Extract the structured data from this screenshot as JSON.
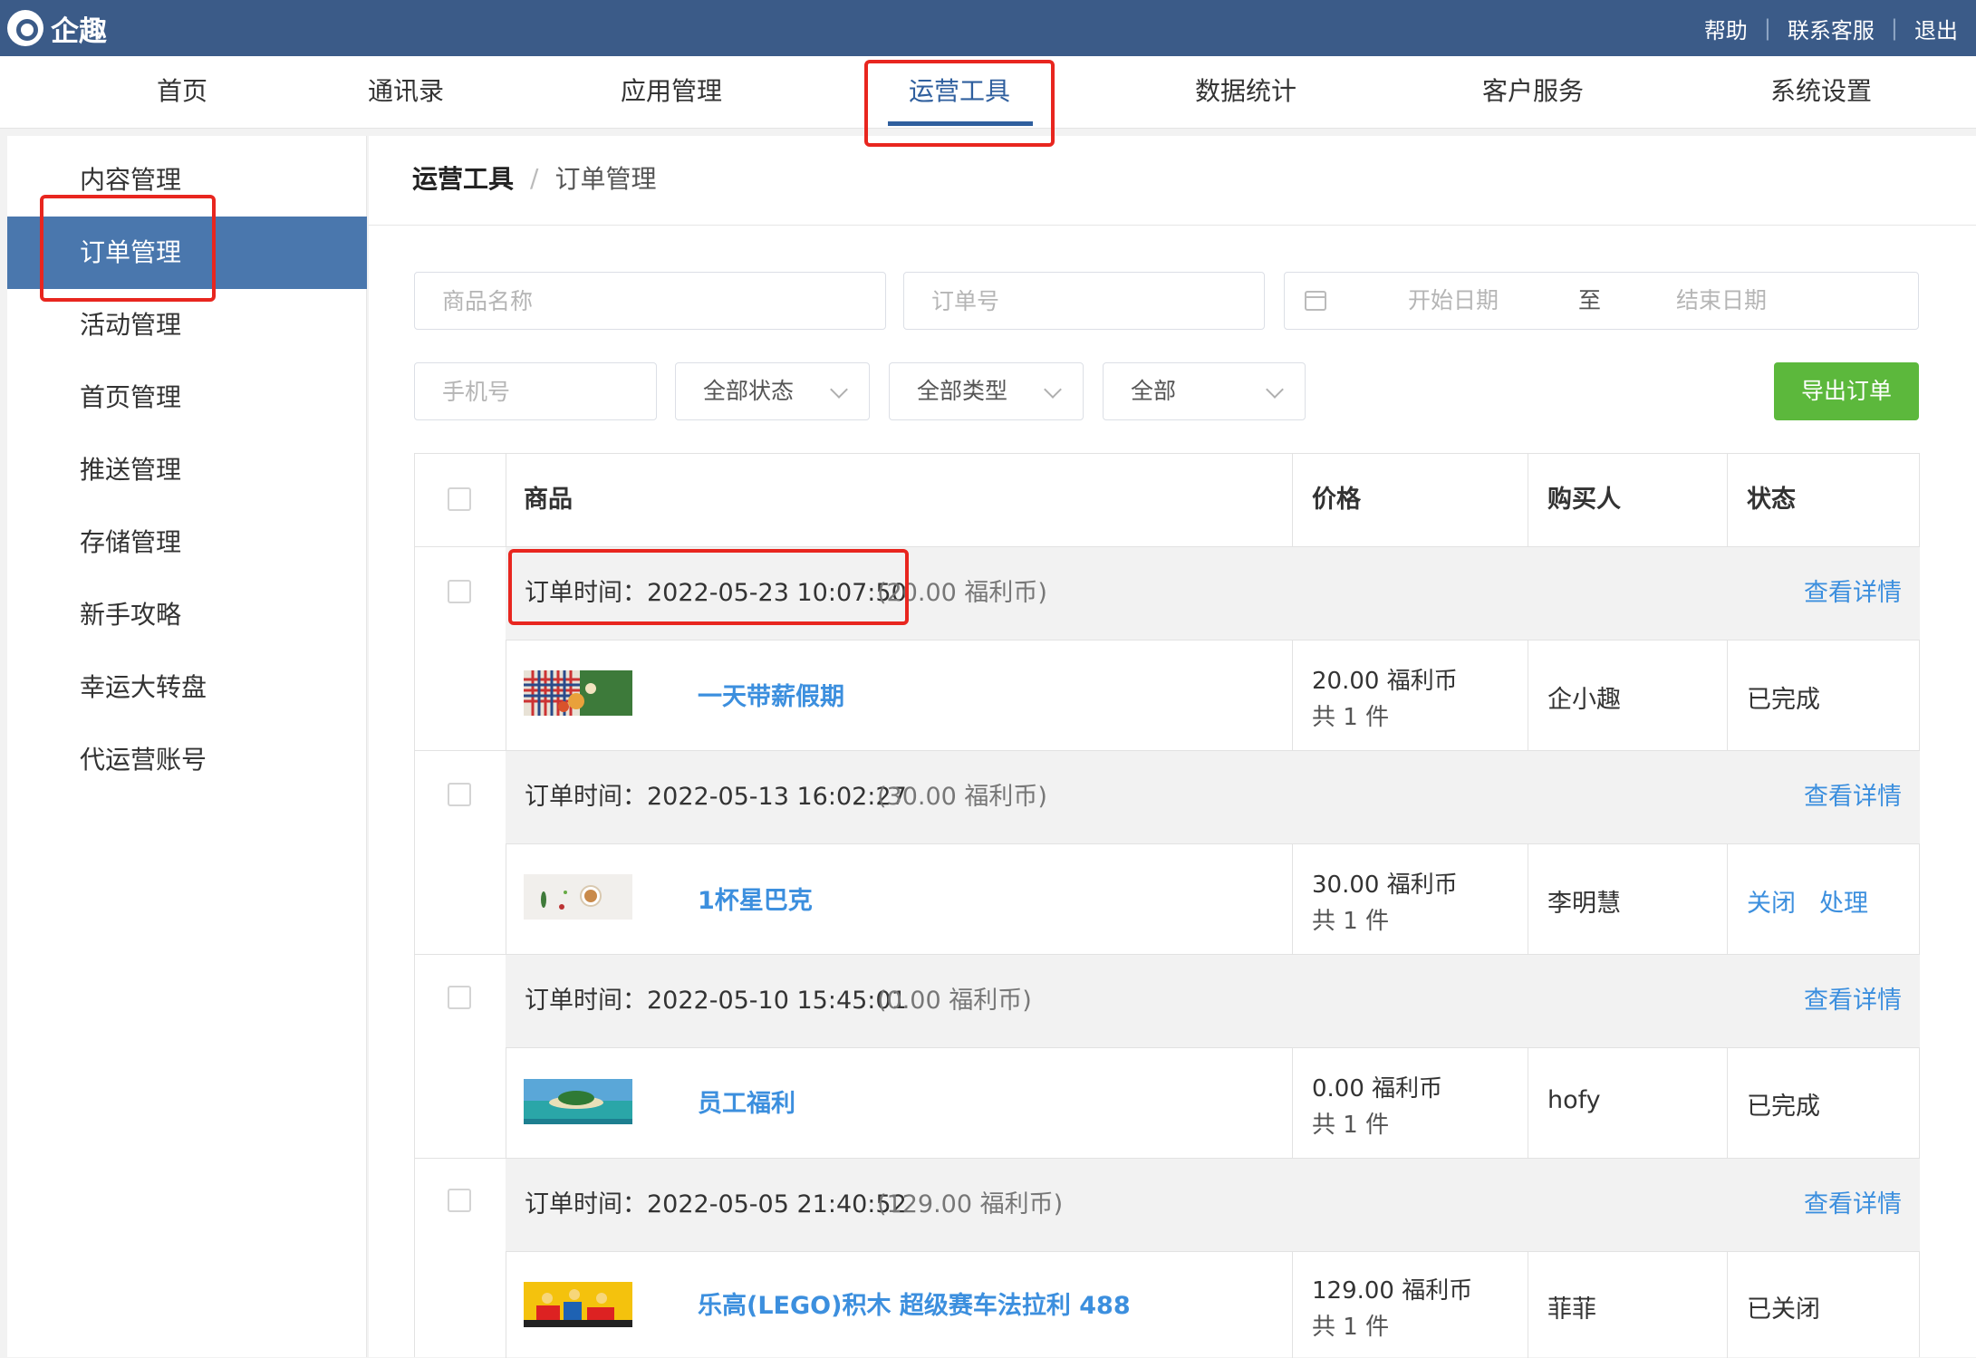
{
  "app": {
    "logo_text": "企趣"
  },
  "top_links": [
    "帮助",
    "联系客服",
    "退出"
  ],
  "main_nav": [
    "首页",
    "通讯录",
    "应用管理",
    "运营工具",
    "数据统计",
    "客户服务",
    "系统设置"
  ],
  "main_nav_active": "运营工具",
  "sidebar": [
    "内容管理",
    "订单管理",
    "活动管理",
    "首页管理",
    "推送管理",
    "存储管理",
    "新手攻略",
    "幸运大转盘",
    "代运营账号"
  ],
  "sidebar_active": "订单管理",
  "breadcrumb": {
    "root": "运营工具",
    "sep": "/",
    "current": "订单管理"
  },
  "filters": {
    "product_placeholder": "商品名称",
    "order_no_placeholder": "订单号",
    "start_date_placeholder": "开始日期",
    "date_to": "至",
    "end_date_placeholder": "结束日期",
    "phone_placeholder": "手机号",
    "status_select": "全部状态",
    "type_select": "全部类型",
    "all_select": "全部",
    "export_button": "导出订单"
  },
  "table": {
    "headers": {
      "product": "商品",
      "price": "价格",
      "buyer": "购买人",
      "status": "状态"
    },
    "orders": [
      {
        "time": "订单时间：2022-05-23 10:07:50",
        "amount": "(20.00 福利币)",
        "detail": "查看详情",
        "product": "一天带薪假期",
        "price": "20.00 福利币",
        "qty": "共 1 件",
        "buyer": "企小趣",
        "status": "已完成"
      },
      {
        "time": "订单时间：2022-05-13 16:02:27",
        "amount": "(30.00 福利币)",
        "detail": "查看详情",
        "product": "1杯星巴克",
        "price": "30.00 福利币",
        "qty": "共 1 件",
        "buyer": "李明慧",
        "actions": [
          "关闭",
          "处理"
        ]
      },
      {
        "time": "订单时间：2022-05-10 15:45:01",
        "amount": "(0.00 福利币)",
        "detail": "查看详情",
        "product": "员工福利",
        "price": "0.00 福利币",
        "qty": "共 1 件",
        "buyer": "hofy",
        "status": "已完成"
      },
      {
        "time": "订单时间：2022-05-05 21:40:52",
        "amount": "(129.00 福利币)",
        "detail": "查看详情",
        "product": "乐高(LEGO)积木 超级赛车法拉利 488",
        "price": "129.00 福利币",
        "qty": "共 1 件",
        "buyer": "菲菲",
        "status": "已关闭"
      }
    ]
  },
  "colors": {
    "topbar": "#3b5b88",
    "active_side": "#4a77ad",
    "link": "#3c8fde",
    "export": "#5cb83c",
    "highlight": "#e8261f"
  }
}
